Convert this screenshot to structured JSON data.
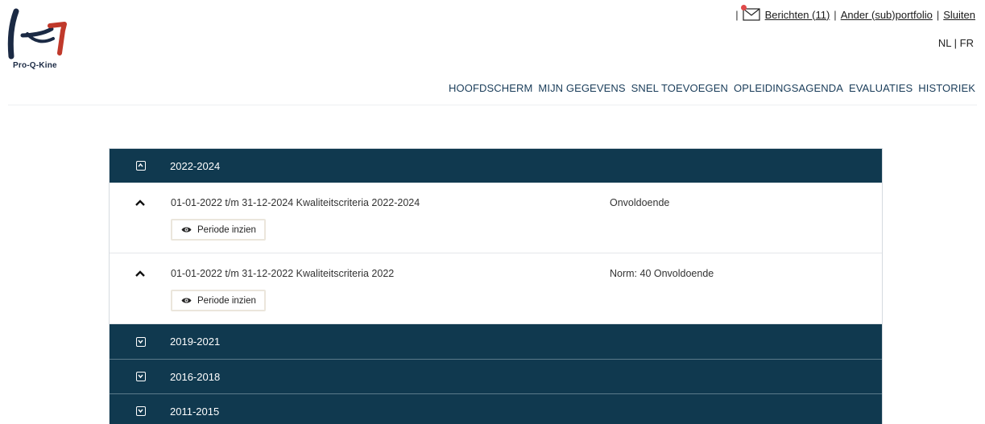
{
  "brand": {
    "name": "Pro-Q-Kine"
  },
  "topbar": {
    "messages_label": "Berichten (11)",
    "portfolio_label": "Ander (sub)portfolio",
    "close_label": "Sluiten",
    "separator": "|"
  },
  "language": {
    "nl": "NL",
    "separator": "|",
    "fr": "FR"
  },
  "nav": {
    "items": [
      "HOOFDSCHERM",
      "MIJN GEGEVENS",
      "SNEL TOEVOEGEN",
      "OPLEIDINGSAGENDA",
      "EVALUATIES",
      "HISTORIEK"
    ]
  },
  "groups": [
    {
      "label": "2022-2024",
      "expanded": true,
      "items": [
        {
          "title": "01-01-2022 t/m 31-12-2024 Kwaliteitscriteria 2022-2024",
          "status": "Onvoldoende",
          "button": "Periode inzien"
        },
        {
          "title": "01-01-2022 t/m 31-12-2022 Kwaliteitscriteria 2022",
          "status": "Norm: 40 Onvoldoende",
          "button": "Periode inzien"
        }
      ]
    },
    {
      "label": "2019-2021",
      "expanded": false
    },
    {
      "label": "2016-2018",
      "expanded": false
    },
    {
      "label": "2011-2015",
      "expanded": false
    }
  ],
  "colors": {
    "header_bg": "#10394f",
    "nav_text": "#1a3d5a",
    "notification_dot": "#e04a4a",
    "logo_red": "#c0392b",
    "logo_navy": "#1b2a44"
  },
  "icons": {
    "mail": "envelope-icon",
    "eye": "eye-icon",
    "expand": "chevron-down-square-icon",
    "collapse": "chevron-up-square-icon",
    "row_toggle": "chevron-up-icon"
  }
}
